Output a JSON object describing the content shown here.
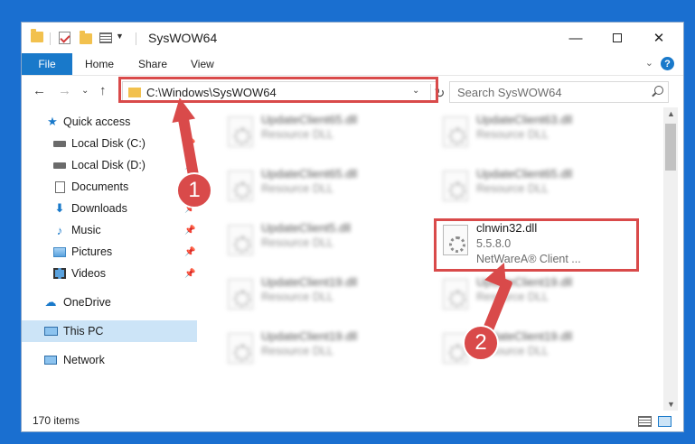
{
  "window": {
    "title": "SysWOW64"
  },
  "ribbon": {
    "tabs": [
      "File",
      "Home",
      "Share",
      "View"
    ],
    "help": "?"
  },
  "address": {
    "path": "C:\\Windows\\SysWOW64",
    "refresh_glyph": "↻"
  },
  "search": {
    "placeholder": "Search SysWOW64"
  },
  "sidebar": {
    "items": [
      {
        "label": "Quick access",
        "icon": "star-icon"
      },
      {
        "label": "Local Disk (C:)",
        "icon": "drive-icon"
      },
      {
        "label": "Local Disk (D:)",
        "icon": "drive-icon"
      },
      {
        "label": "Documents",
        "icon": "documents-icon"
      },
      {
        "label": "Downloads",
        "icon": "download-icon"
      },
      {
        "label": "Music",
        "icon": "music-icon"
      },
      {
        "label": "Pictures",
        "icon": "pictures-icon"
      },
      {
        "label": "Videos",
        "icon": "videos-icon"
      },
      {
        "label": "OneDrive",
        "icon": "cloud-icon"
      },
      {
        "label": "This PC",
        "icon": "computer-icon",
        "selected": true
      },
      {
        "label": "Network",
        "icon": "network-icon"
      }
    ]
  },
  "files": {
    "left": [
      {
        "name": "UpdateClient65.dll",
        "type": "Resource DLL"
      },
      {
        "name": "UpdateClient65.dll",
        "type": "Resource DLL"
      },
      {
        "name": "UpdateClient5.dll",
        "type": "Resource DLL"
      },
      {
        "name": "UpdateClient19.dll",
        "type": "Resource DLL"
      },
      {
        "name": "UpdateClient19.dll",
        "type": "Resource DLL"
      }
    ],
    "right": [
      {
        "name": "UpdateClient63.dll",
        "type": "Resource DLL"
      },
      {
        "name": "UpdateClient65.dll",
        "type": "Resource DLL"
      },
      {
        "name": "UpdateClient19.dll",
        "type": "Resource DLL"
      },
      {
        "name": "UpdateClient19.dll",
        "type": "Resource DLL"
      }
    ],
    "highlighted": {
      "name": "clnwin32.dll",
      "version": "5.5.8.0",
      "company": "NetWareA® Client ..."
    }
  },
  "status": {
    "item_count": "170 items"
  },
  "annotations": {
    "step1": "1",
    "step2": "2",
    "color": "#d94a4a"
  },
  "colors": {
    "accent": "#1979ca",
    "desktop": "#1a6fd0",
    "selection": "#cce4f7"
  }
}
